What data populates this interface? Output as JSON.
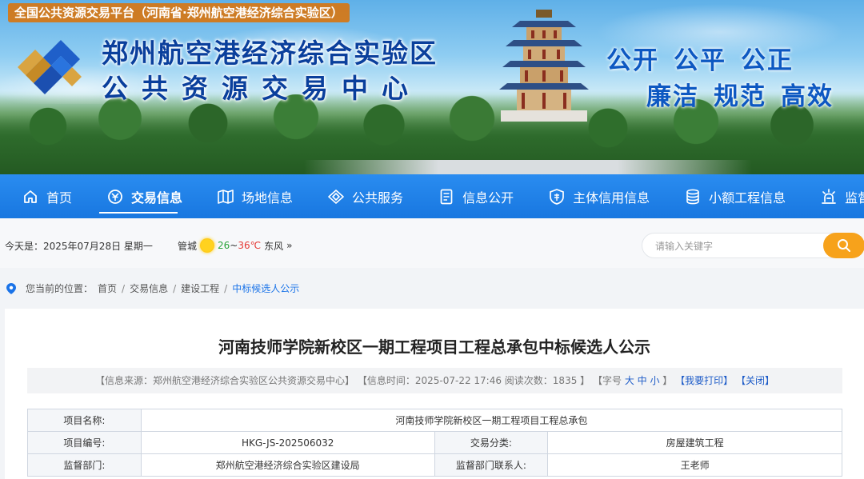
{
  "banner": {
    "platform": "全国公共资源交易平台（河南省·郑州航空港经济综合实验区）",
    "org_line1": "郑州航空港经济综合实验区",
    "org_line2": "公共资源交易中心",
    "slogans_row1": [
      "公开",
      "公平",
      "公正"
    ],
    "slogans_row2": [
      "廉洁",
      "规范",
      "高效"
    ]
  },
  "nav": {
    "items": [
      {
        "label": "首页",
        "icon": "home-icon"
      },
      {
        "label": "交易信息",
        "icon": "trade-icon"
      },
      {
        "label": "场地信息",
        "icon": "map-icon"
      },
      {
        "label": "公共服务",
        "icon": "diamond-icon"
      },
      {
        "label": "信息公开",
        "icon": "document-icon"
      },
      {
        "label": "主体信用信息",
        "icon": "credit-icon"
      },
      {
        "label": "小额工程信息",
        "icon": "coins-icon"
      },
      {
        "label": "监督举报",
        "icon": "supervise-icon"
      }
    ],
    "active_index": 1
  },
  "infobar": {
    "today": "今天是：2025年07月28日 星期一",
    "city": "管城",
    "temp_low": "26",
    "temp_sep": "~",
    "temp_high": "36℃",
    "wind": "东风",
    "more": "»",
    "search_placeholder": "请输入关键字"
  },
  "breadcrumb": {
    "label": "您当前的位置：",
    "items": [
      "首页",
      "交易信息",
      "建设工程",
      "中标候选人公示"
    ]
  },
  "article": {
    "title": "河南技师学院新校区一期工程项目工程总承包中标候选人公示",
    "meta_source": "【信息来源：郑州航空港经济综合实验区公共资源交易中心】",
    "meta_time": "【信息时间：2025-07-22 17:46 阅读次数：1835 】",
    "meta_font_label": "【字号",
    "meta_font_sizes": "大 中 小",
    "meta_font_end": "】",
    "meta_print": "【我要打印】",
    "meta_close": "【关闭】"
  },
  "table": {
    "rows": [
      {
        "label": "项目名称:",
        "value": "河南技师学院新校区一期工程项目工程总承包"
      },
      {
        "label": "项目编号:",
        "value": "HKG-JS-202506032",
        "label2": "交易分类:",
        "value2": "房屋建筑工程"
      },
      {
        "label": "监督部门:",
        "value": "郑州航空港经济综合实验区建设局",
        "label2": "监督部门联系人:",
        "value2": "王老师"
      }
    ]
  },
  "colors": {
    "nav_blue": "#1877e0",
    "accent_orange": "#f7a21b",
    "link_blue": "#1a73e8",
    "title_blue": "#0a3f9c"
  }
}
